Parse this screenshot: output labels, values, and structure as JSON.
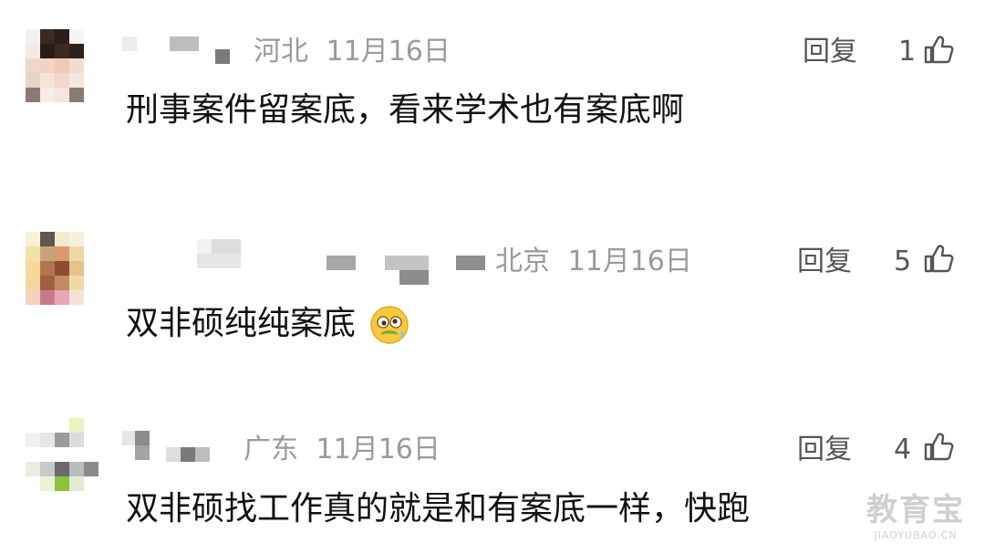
{
  "comments": [
    {
      "location": "河北",
      "date": "11月16日",
      "reply_label": "回复",
      "likes": "1",
      "text": "刑事案件留案底，看来学术也有案底啊"
    },
    {
      "location": "北京",
      "date": "11月16日",
      "reply_label": "回复",
      "likes": "5",
      "text": "双非硕纯纯案底",
      "emoji": "woozy-face-icon"
    },
    {
      "location": "广东",
      "date": "11月16日",
      "reply_label": "回复",
      "likes": "4",
      "text": "双非硕找工作真的就是和有案底一样，快跑"
    }
  ],
  "watermark": {
    "main": "教育宝",
    "sub": "JIAOYUBAO.CN"
  },
  "colors": {
    "text": "#111111",
    "meta": "#9a9a9a",
    "action": "#555555"
  }
}
